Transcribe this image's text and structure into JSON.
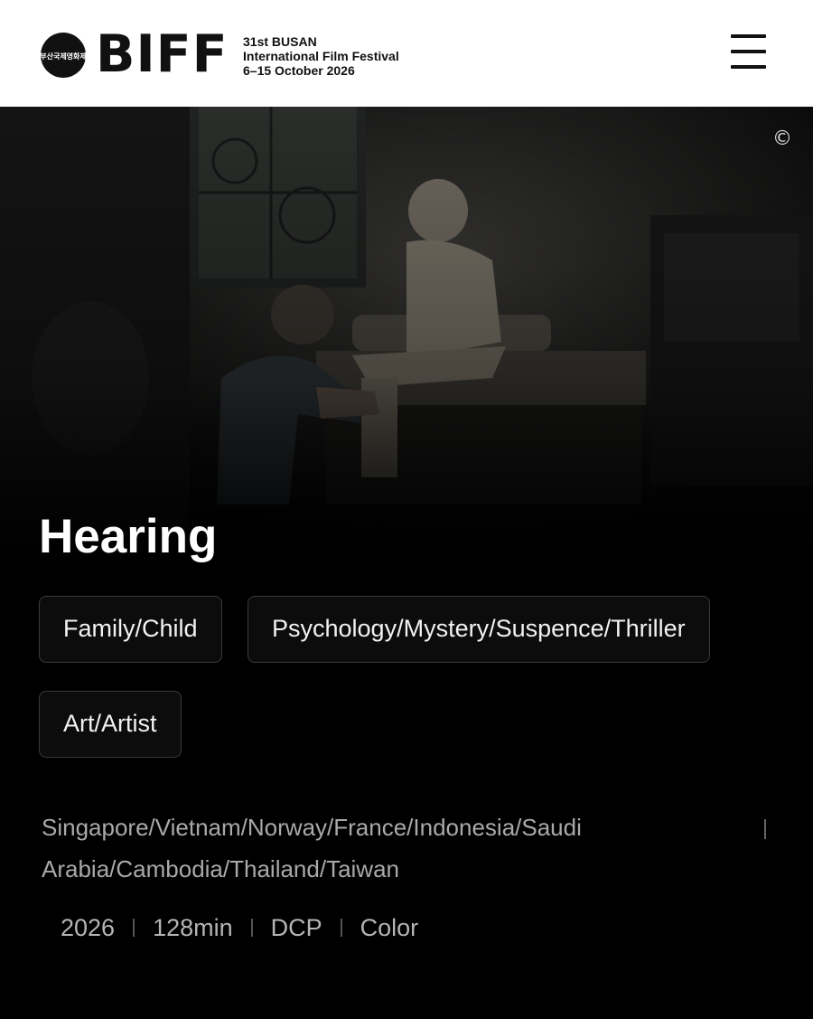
{
  "header": {
    "logo_text": "BIFF",
    "logo_korean": "부산국제영화제",
    "edition": "31st BUSAN",
    "festival_name": "International Film Festival",
    "dates": "6–15 October 2026",
    "menu_icon": "hamburger-menu-icon"
  },
  "hero": {
    "image": "Film still: man kneeling beside elderly woman seated on a bed in a dim room",
    "copyright_icon": "copyright-icon",
    "copyright_symbol": "©"
  },
  "film": {
    "title": "Hearing",
    "genres": [
      "Family/Child",
      "Psychology/Mystery/Suspence/Thriller",
      "Art/Artist"
    ],
    "countries_line1": "Singapore/Vietnam/Norway/France/Indonesia/Saudi",
    "countries_line2": "Arabia/Cambodia/Thailand/Taiwan",
    "year": "2026",
    "runtime": "128min",
    "format": "DCP",
    "color": "Color"
  },
  "colors": {
    "background": "#000000",
    "header_bg": "#ffffff",
    "tag_border": "#3a3a3a",
    "muted_text": "#a9a9a9"
  }
}
